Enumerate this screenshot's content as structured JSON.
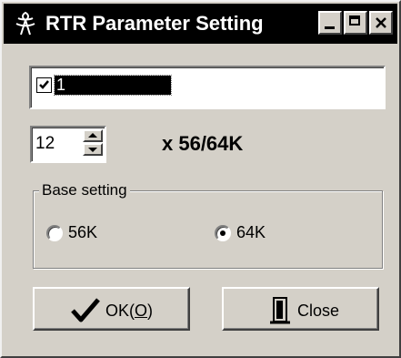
{
  "window": {
    "title": "RTR Parameter Setting",
    "icon": "rtr-antenna-icon",
    "controls": [
      "minimize-icon",
      "maximize-icon",
      "close-icon"
    ]
  },
  "list": {
    "items": [
      {
        "label": "1",
        "checked": true,
        "selected": true
      }
    ]
  },
  "multiplier": {
    "value": "12",
    "unit_text": "x 56/64K"
  },
  "base_setting": {
    "group_label": "Base setting",
    "options": [
      {
        "label": "56K",
        "checked": false
      },
      {
        "label": "64K",
        "checked": true
      }
    ]
  },
  "buttons": {
    "ok": {
      "label_prefix": "OK(",
      "mnemonic": "O",
      "label_suffix": ")",
      "icon": "checkmark-icon"
    },
    "close": {
      "label": "Close",
      "icon": "door-exit-icon"
    }
  },
  "colors": {
    "titlebar": "#000000",
    "face": "#d4d0c8",
    "ok_check": "#000000"
  }
}
